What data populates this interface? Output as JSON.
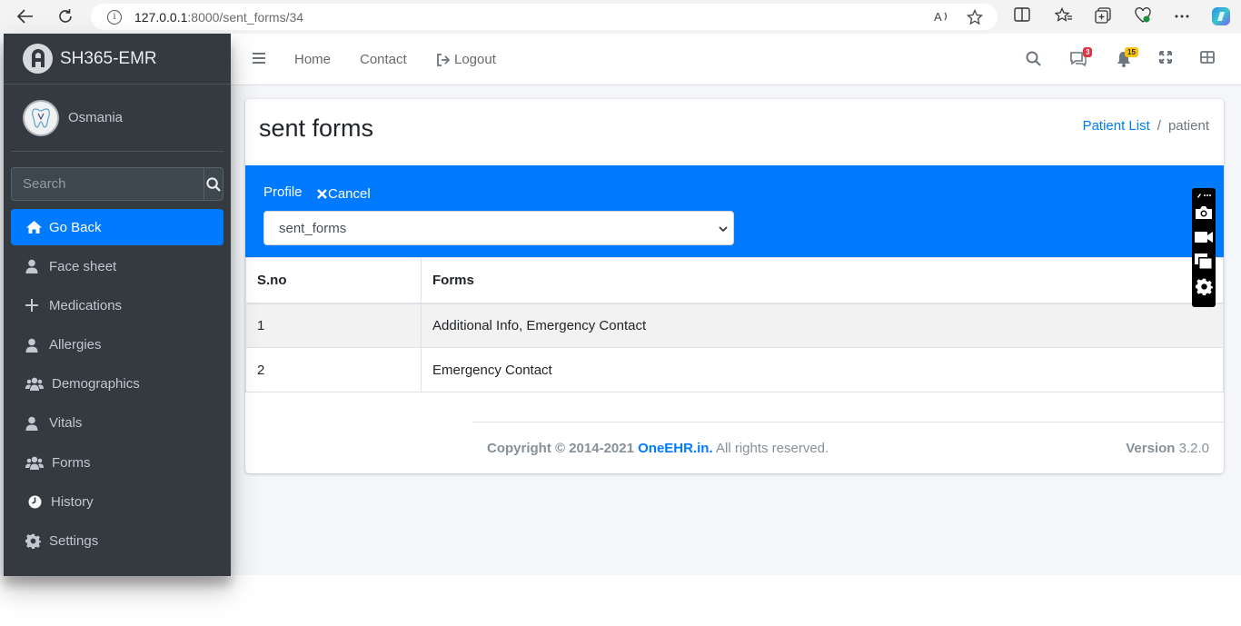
{
  "browser": {
    "url_host": "127.0.0.1",
    "url_path": ":8000/sent_forms/34"
  },
  "sidebar": {
    "brand": "SH365-EMR",
    "user": "Osmania",
    "search_placeholder": "Search",
    "items": [
      {
        "label": "Go Back",
        "icon": "home-icon",
        "active": true
      },
      {
        "label": "Face sheet",
        "icon": "user-icon"
      },
      {
        "label": "Medications",
        "icon": "plus-icon"
      },
      {
        "label": "Allergies",
        "icon": "user-icon"
      },
      {
        "label": "Demographics",
        "icon": "users-icon"
      },
      {
        "label": "Vitals",
        "icon": "user-icon"
      },
      {
        "label": "Forms",
        "icon": "users-icon"
      },
      {
        "label": "History",
        "icon": "clock-icon"
      },
      {
        "label": "Settings",
        "icon": "gear-icon"
      }
    ]
  },
  "topnav": {
    "home": "Home",
    "contact": "Contact",
    "logout": "Logout",
    "messages_badge": "3",
    "notifications_badge": "15"
  },
  "content": {
    "title": "sent forms",
    "breadcrumb_link": "Patient List",
    "breadcrumb_sep": "/",
    "breadcrumb_current": "patient",
    "profile_label": "Profile",
    "cancel_label": "Cancel",
    "select_value": "sent_forms"
  },
  "table": {
    "headers": [
      "S.no",
      "Forms"
    ],
    "rows": [
      [
        "1",
        "Additional Info, Emergency Contact"
      ],
      [
        "2",
        "Emergency Contact"
      ]
    ]
  },
  "footer": {
    "copyright_prefix": "Copyright © 2014-2021",
    "brand": "OneEHR.in.",
    "rights": "All rights reserved.",
    "version_label": "Version",
    "version": "3.2.0"
  },
  "colors": {
    "primary": "#007bff",
    "sidebar_bg": "#343a40"
  }
}
